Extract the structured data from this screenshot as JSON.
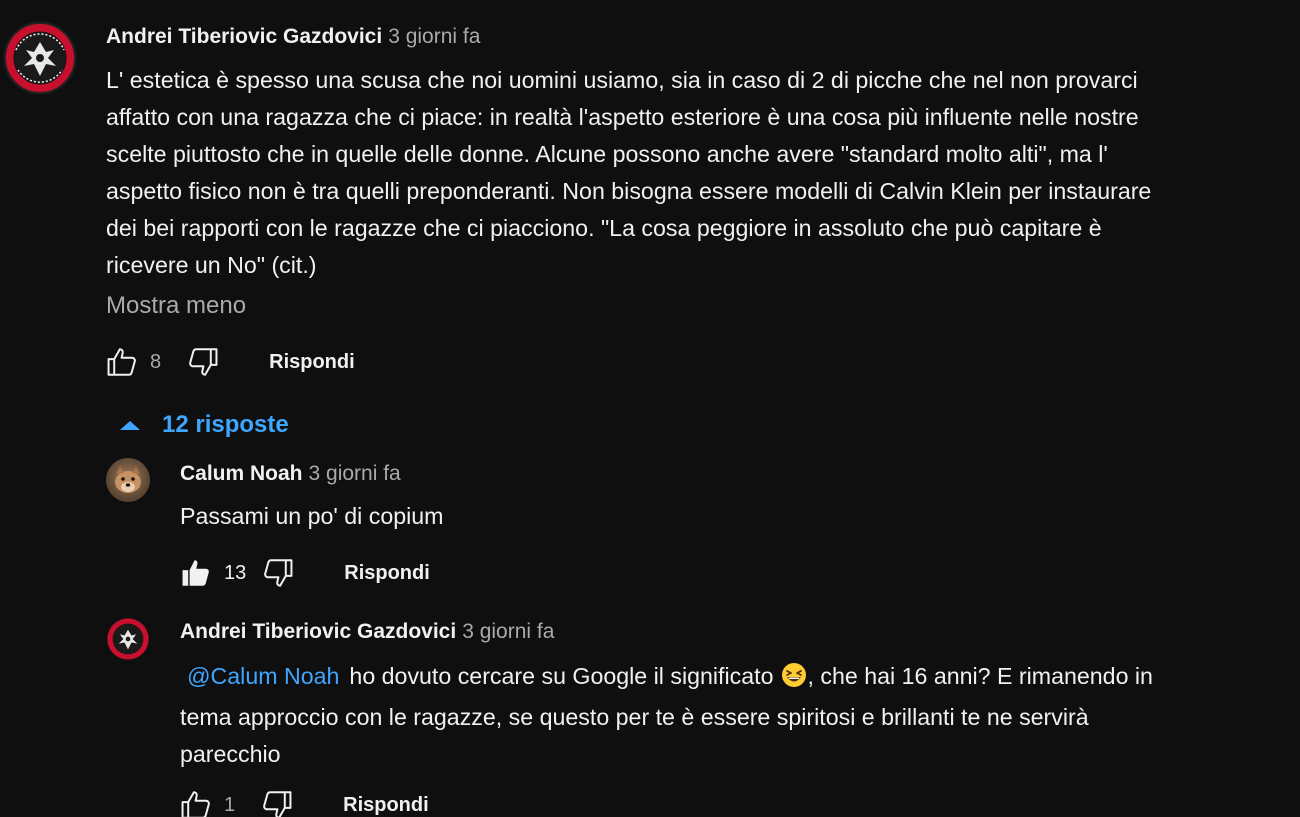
{
  "thread": {
    "main": {
      "author": "Andrei Tiberiovic Gazdovici",
      "time": "3 giorni fa",
      "text_lines": [
        "L' estetica è spesso una scusa che noi uomini usiamo, sia in caso di 2 di picche che nel non provarci",
        "affatto con una ragazza che ci piace: in realtà l'aspetto esteriore è una cosa più influente nelle nostre",
        "scelte piuttosto che in quelle delle donne. Alcune possono anche avere \"standard molto alti\", ma l'",
        "aspetto fisico non è tra quelli preponderanti. Non bisogna essere modelli di Calvin Klein per instaurare",
        "dei bei rapporti con le ragazze che ci piacciono. \"La cosa peggiore in assoluto che può capitare è",
        "ricevere un No\" (cit.)"
      ],
      "show_less": "Mostra meno",
      "likes": "8",
      "reply_label": "Rispondi",
      "avatar_icon": "channel-logo-avatar"
    },
    "replies_toggle": {
      "label": "12 risposte",
      "icon": "caret-up-icon"
    },
    "replies": [
      {
        "author": "Calum Noah",
        "time": "3 giorni fa",
        "text": "Passami un po' di copium",
        "likes": "13",
        "liked": true,
        "reply_label": "Rispondi",
        "avatar_icon": "dog-photo-avatar"
      },
      {
        "author": "Andrei Tiberiovic Gazdovici",
        "time": "3 giorni fa",
        "mention": "@Calum Noah",
        "line1_text": "ho dovuto cercare su Google il significato",
        "line1_after": ", che hai 16 anni? E rimanendo in",
        "line2": "tema approccio con le ragazze, se questo per te è essere spiritosi e brillanti te ne servirà",
        "line3": "parecchio",
        "emoji": "grinning-squinting-face",
        "likes": "1",
        "liked": false,
        "reply_label": "Rispondi",
        "avatar_icon": "channel-logo-avatar"
      }
    ]
  },
  "colors": {
    "background": "#0f0f0f",
    "text_primary": "#f1f1f1",
    "text_secondary": "#aaaaaa",
    "link_blue": "#3ea6ff"
  }
}
